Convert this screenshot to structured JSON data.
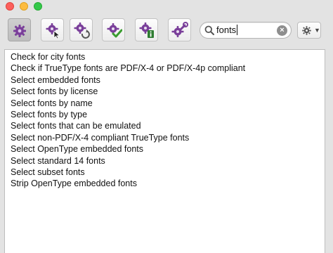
{
  "window": {
    "traffic_lights": {
      "close": "#fc605c",
      "minimize": "#fdbc40",
      "maximize": "#34c84a"
    }
  },
  "toolbar": {
    "tools": [
      {
        "icon": "gear-icon",
        "active": true
      },
      {
        "icon": "gear-cursor-icon",
        "active": false
      },
      {
        "icon": "gear-refresh-icon",
        "active": false
      },
      {
        "icon": "gear-check-icon",
        "active": false
      },
      {
        "icon": "gear-info-icon",
        "active": false
      },
      {
        "icon": "gear-wrench-icon",
        "active": false
      }
    ],
    "accent_color": "#7a3f9a"
  },
  "search": {
    "value": "fonts",
    "clear_icon": "clear-icon",
    "search_icon": "search-icon"
  },
  "action_menu": {
    "icon": "gear-icon",
    "dropdown_icon": "chevron-down-icon"
  },
  "results": [
    "Check for city fonts",
    "Check if TrueType fonts are PDF/X-4 or PDF/X-4p compliant",
    "Select embedded fonts",
    "Select fonts by license",
    "Select fonts by name",
    "Select fonts by type",
    "Select fonts that can be emulated",
    "Select non-PDF/X-4 compliant TrueType fonts",
    "Select OpenType embedded fonts",
    "Select standard 14 fonts",
    "Select subset fonts",
    "Strip OpenType embedded fonts"
  ]
}
